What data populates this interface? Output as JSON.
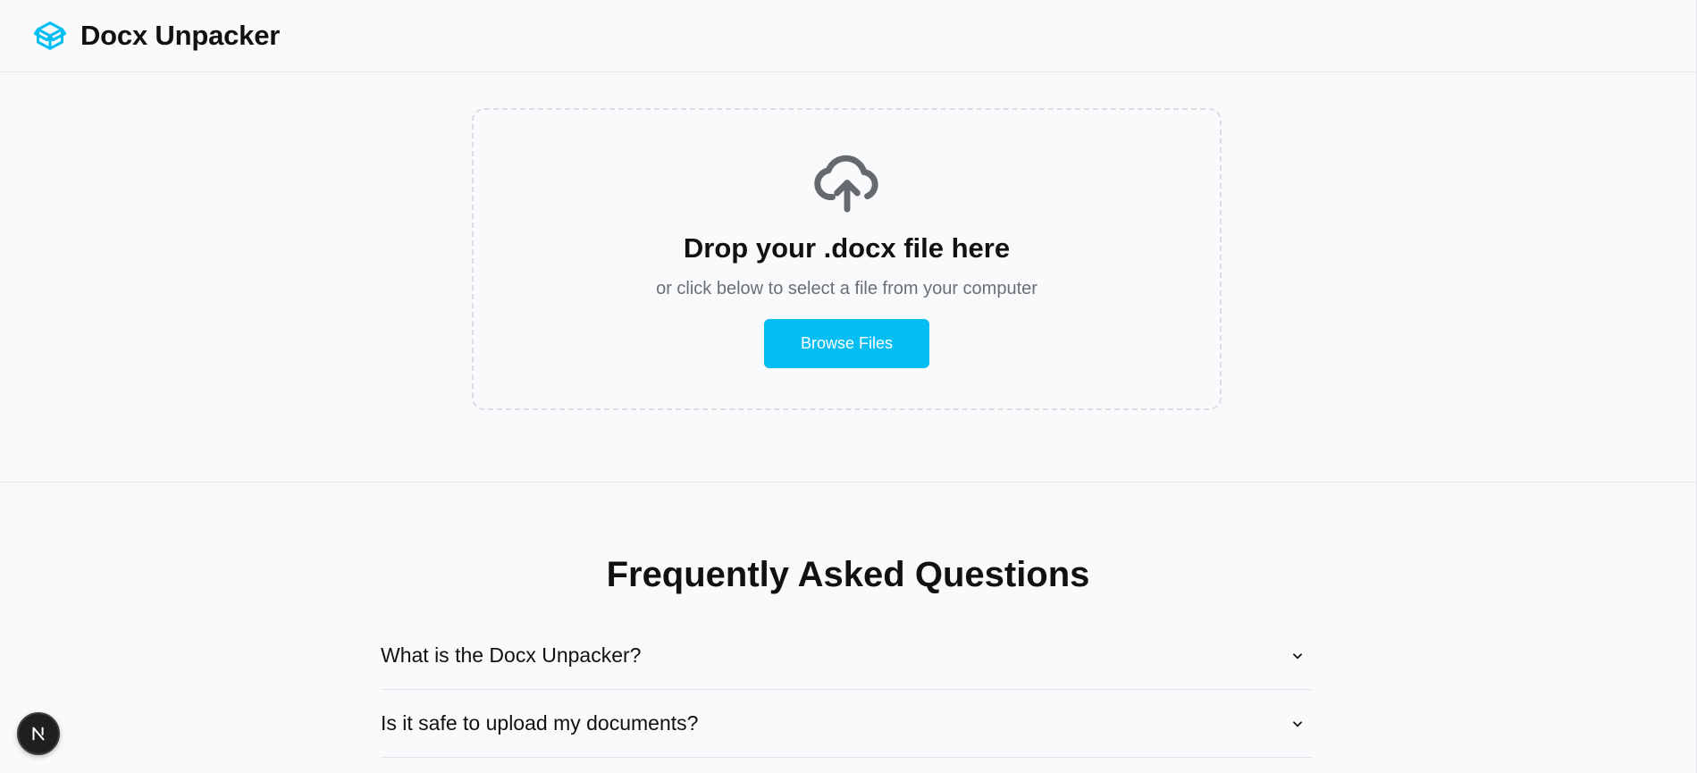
{
  "header": {
    "brand": "Docx Unpacker",
    "logo_icon": "open-box-icon",
    "accent_color": "#03bdf3"
  },
  "upload": {
    "icon": "cloud-upload-icon",
    "title": "Drop your .docx file here",
    "subtitle": "or click below to select a file from your computer",
    "button_label": "Browse Files",
    "button_color": "#03bdf3"
  },
  "faq": {
    "title": "Frequently Asked Questions",
    "items": [
      {
        "question": "What is the Docx Unpacker?"
      },
      {
        "question": "Is it safe to upload my documents?"
      }
    ]
  },
  "dev_badge": {
    "icon": "next-logo-icon",
    "letter": "N"
  }
}
